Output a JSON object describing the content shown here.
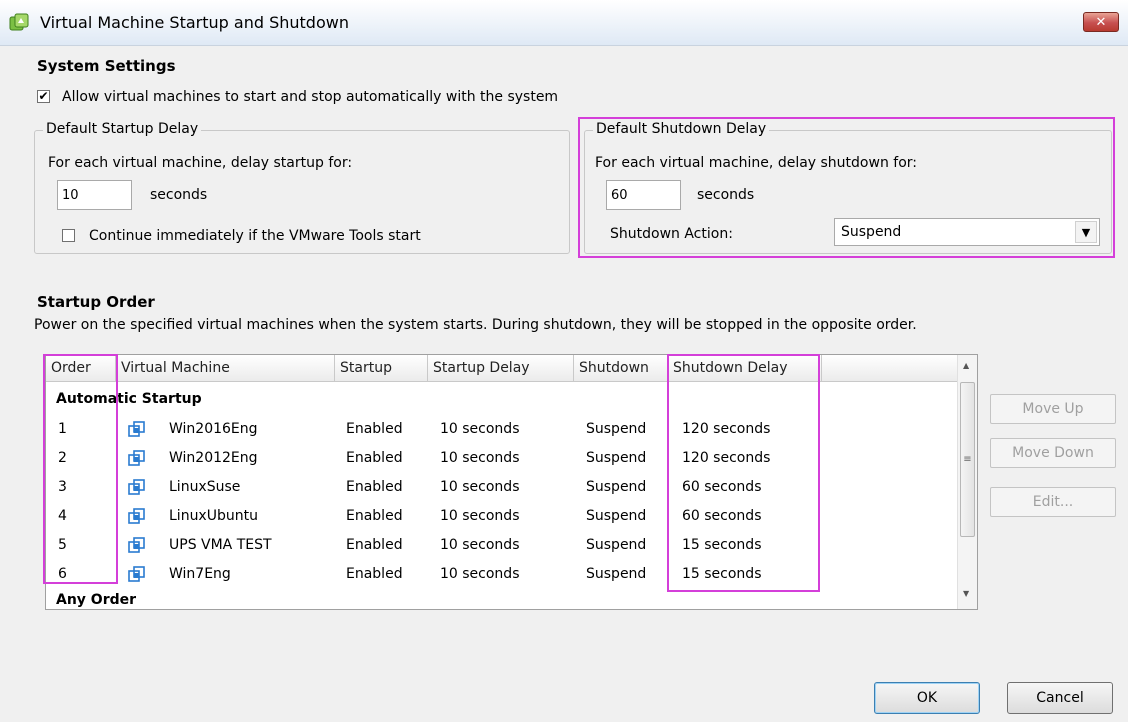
{
  "window": {
    "title": "Virtual Machine Startup and Shutdown",
    "close_icon": "close-icon"
  },
  "system_settings": {
    "heading": "System Settings",
    "allow_auto_label": "Allow virtual machines to start and stop automatically with the system",
    "allow_auto_checked": "✔"
  },
  "startup_delay": {
    "legend": "Default Startup Delay",
    "description": "For each virtual machine, delay startup for:",
    "value": "10",
    "unit": "seconds",
    "continue_label": "Continue immediately if the VMware Tools start",
    "continue_checked": ""
  },
  "shutdown_delay": {
    "legend": "Default Shutdown Delay",
    "description": "For each virtual machine, delay shutdown for:",
    "value": "60",
    "unit": "seconds",
    "action_label": "Shutdown Action:",
    "action_value": "Suspend"
  },
  "startup_order": {
    "heading": "Startup Order",
    "description": "Power on the specified virtual machines when the system starts. During shutdown, they will be stopped in the opposite order.",
    "columns": [
      "Order",
      "Virtual Machine",
      "Startup",
      "Startup Delay",
      "Shutdown",
      "Shutdown Delay"
    ],
    "group_automatic": "Automatic Startup",
    "group_any": "Any Order",
    "rows": [
      {
        "order": "1",
        "vm": "Win2016Eng",
        "startup": "Enabled",
        "startup_delay": "10 seconds",
        "shutdown": "Suspend",
        "shutdown_delay": "120 seconds"
      },
      {
        "order": "2",
        "vm": "Win2012Eng",
        "startup": "Enabled",
        "startup_delay": "10 seconds",
        "shutdown": "Suspend",
        "shutdown_delay": "120 seconds"
      },
      {
        "order": "3",
        "vm": "LinuxSuse",
        "startup": "Enabled",
        "startup_delay": "10 seconds",
        "shutdown": "Suspend",
        "shutdown_delay": "60 seconds"
      },
      {
        "order": "4",
        "vm": "LinuxUbuntu",
        "startup": "Enabled",
        "startup_delay": "10 seconds",
        "shutdown": "Suspend",
        "shutdown_delay": "60 seconds"
      },
      {
        "order": "5",
        "vm": "UPS VMA TEST",
        "startup": "Enabled",
        "startup_delay": "10 seconds",
        "shutdown": "Suspend",
        "shutdown_delay": "15 seconds"
      },
      {
        "order": "6",
        "vm": "Win7Eng",
        "startup": "Enabled",
        "startup_delay": "10 seconds",
        "shutdown": "Suspend",
        "shutdown_delay": "15 seconds"
      }
    ]
  },
  "side_buttons": {
    "move_up": "Move Up",
    "move_down": "Move Down",
    "edit": "Edit..."
  },
  "dialog_buttons": {
    "ok": "OK",
    "cancel": "Cancel"
  },
  "colors": {
    "highlight": "#d43fd9",
    "vm_icon": "#2a7bd0"
  }
}
